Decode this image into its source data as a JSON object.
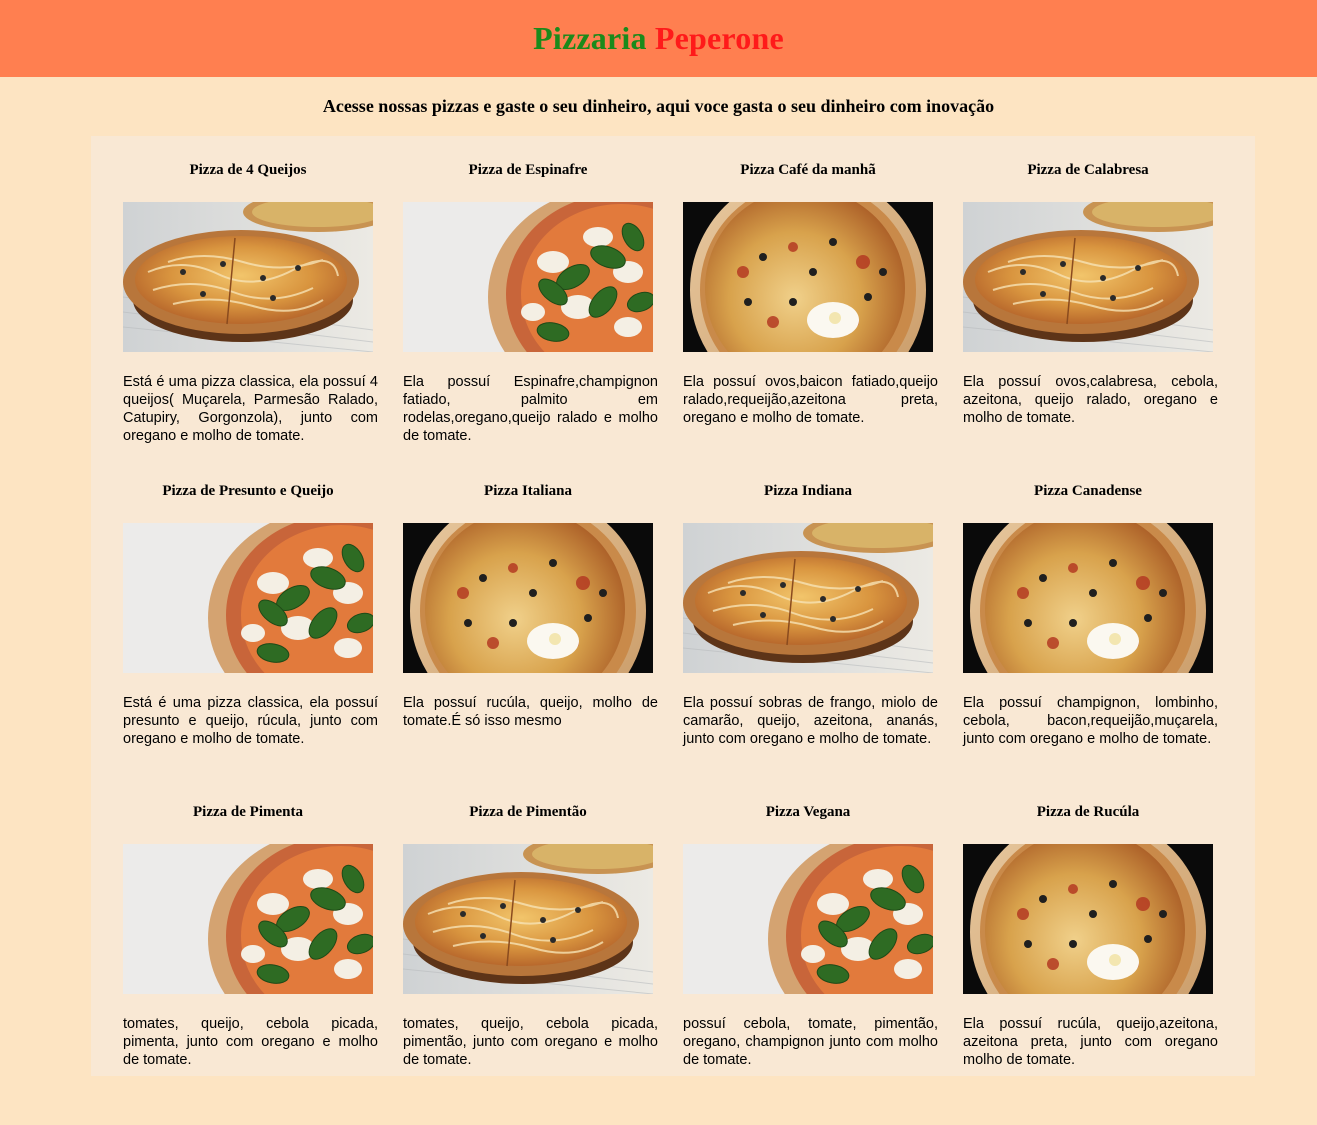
{
  "header": {
    "title_part1": "Pizzaria",
    "title_part2": "Peperone",
    "color_part1": "#1b8a1b",
    "color_part2": "#ff1a1a",
    "background": "#ff7f50"
  },
  "tagline": "Acesse nossas pizzas e gaste o seu dinheiro, aqui voce gasta o seu dinheiro com inovação",
  "pizzas": [
    {
      "name": "Pizza de 4 Queijos",
      "image": "pizza-classic-photo",
      "description": "Está é uma pizza classica, ela possuí 4 queijos( Muçarela, Parmesão Ralado, Catupiry, Gorgonzola), junto com oregano e molho de tomate."
    },
    {
      "name": "Pizza de Espinafre",
      "image": "pizza-basil-photo",
      "description": "Ela possuí Espinafre,champignon fatiado, palmito em rodelas,oregano,queijo ralado e molho de tomate."
    },
    {
      "name": "Pizza Café da manhã",
      "image": "pizza-egg-photo",
      "description": "Ela possuí ovos,baicon fatiado,queijo ralado,requeijão,azeitona preta, oregano e molho de tomate."
    },
    {
      "name": "Pizza de Calabresa",
      "image": "pizza-classic-photo",
      "description": "Ela possuí ovos,calabresa, cebola, azeitona, queijo ralado, oregano e molho de tomate."
    },
    {
      "name": "Pizza de Presunto e Queijo",
      "image": "pizza-basil-photo",
      "description": "Está é uma pizza classica, ela possuí presunto e queijo, rúcula, junto com oregano e molho de tomate."
    },
    {
      "name": "Pizza Italiana",
      "image": "pizza-egg-photo",
      "description": "Ela possuí rucúla, queijo, molho de tomate.É só isso mesmo"
    },
    {
      "name": "Pizza Indiana",
      "image": "pizza-classic-photo",
      "description": "Ela possuí sobras de frango, miolo de camarão, queijo, azeitona, ananás, junto com oregano e molho de tomate."
    },
    {
      "name": "Pizza Canadense",
      "image": "pizza-egg-photo",
      "description": "Ela possuí champignon, lombinho, cebola, bacon,requeijão,muçarela, junto com oregano e molho de tomate."
    },
    {
      "name": "Pizza de Pimenta",
      "image": "pizza-basil-photo",
      "description": "tomates, queijo, cebola picada, pimenta, junto com oregano e molho de tomate."
    },
    {
      "name": "Pizza de Pimentão",
      "image": "pizza-classic-photo",
      "description": "tomates, queijo, cebola picada, pimentão, junto com oregano e molho de tomate."
    },
    {
      "name": "Pizza Vegana",
      "image": "pizza-basil-photo",
      "description": "possuí cebola, tomate, pimentão, oregano, champignon junto com molho de tomate."
    },
    {
      "name": "Pizza de Rucúla",
      "image": "pizza-egg-photo",
      "description": "Ela possuí rucúla, queijo,azeitona, azeitona preta, junto com oregano molho de tomate."
    }
  ]
}
